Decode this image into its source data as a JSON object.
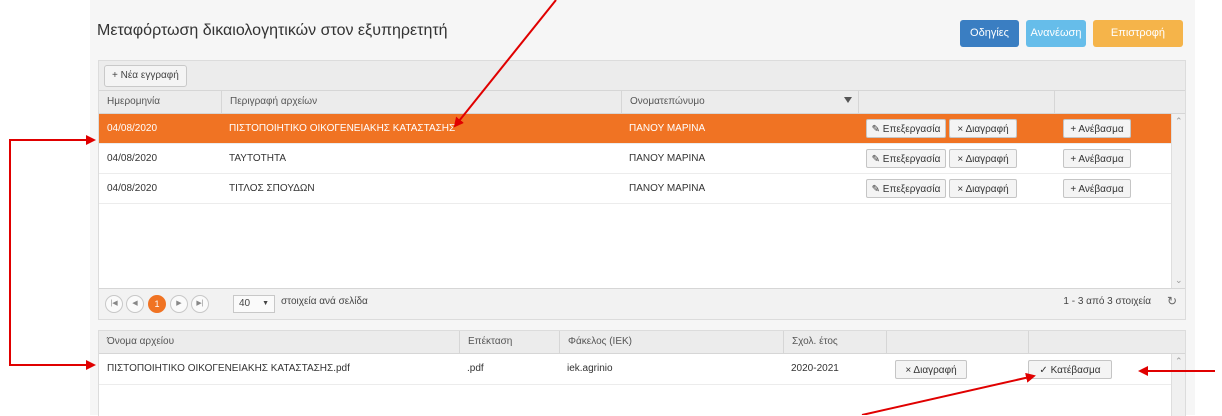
{
  "header": {
    "title": "Μεταφόρτωση δικαιολογητικών στον εξυπηρετητή",
    "buttons": [
      {
        "label": "Οδηγίες",
        "color": "#3a7ec2"
      },
      {
        "label": "Ανανέωση",
        "color": "#66bdea"
      },
      {
        "label": "Επιστροφή",
        "color": "#f5b44a"
      }
    ]
  },
  "toolbar": {
    "new_label": "+ Νέα εγγραφή"
  },
  "grid1": {
    "columns": [
      "Ημερομηνία",
      "Περιγραφή αρχείων",
      "Ονοματεπώνυμο"
    ],
    "rows": [
      {
        "date": "04/08/2020",
        "desc": "ΠΙΣΤΟΠΟΙΗΤΙΚΟ ΟΙΚΟΓΕΝΕΙΑΚΗΣ ΚΑΤΑΣΤΑΣΗΣ",
        "name": "ΠΑΝΟΥ ΜΑΡΙΝΑ",
        "selected": true
      },
      {
        "date": "04/08/2020",
        "desc": "ΤΑΥΤΟΤΗΤΑ",
        "name": "ΠΑΝΟΥ ΜΑΡΙΝΑ",
        "selected": false
      },
      {
        "date": "04/08/2020",
        "desc": "ΤΙΤΛΟΣ ΣΠΟΥΔΩΝ",
        "name": "ΠΑΝΟΥ ΜΑΡΙΝΑ",
        "selected": false
      }
    ],
    "edit_label": "Επεξεργασία",
    "delete_label": "Διαγραφή",
    "upload_label": "+ Ανέβασμα",
    "pager": {
      "current_page": "1",
      "page_size": "40",
      "page_size_label": "στοιχεία ανά σελίδα",
      "summary": "1 - 3 από 3 στοιχεία"
    }
  },
  "grid2": {
    "columns": [
      "Όνομα αρχείου",
      "Επέκταση",
      "Φάκελος (ΙΕΚ)",
      "Σχολ. έτος"
    ],
    "rows": [
      {
        "filename": "ΠΙΣΤΟΠΟΙΗΤΙΚΟ ΟΙΚΟΓΕΝΕΙΑΚΗΣ ΚΑΤΑΣΤΑΣΗΣ.pdf",
        "ext": ".pdf",
        "folder": "iek.agrinio",
        "year": "2020-2021"
      }
    ],
    "delete_label": "× Διαγραφή",
    "download_label": "✓ Κατέβασμα"
  },
  "colors": {
    "accent": "#f07323",
    "annotation": "#e00000"
  }
}
